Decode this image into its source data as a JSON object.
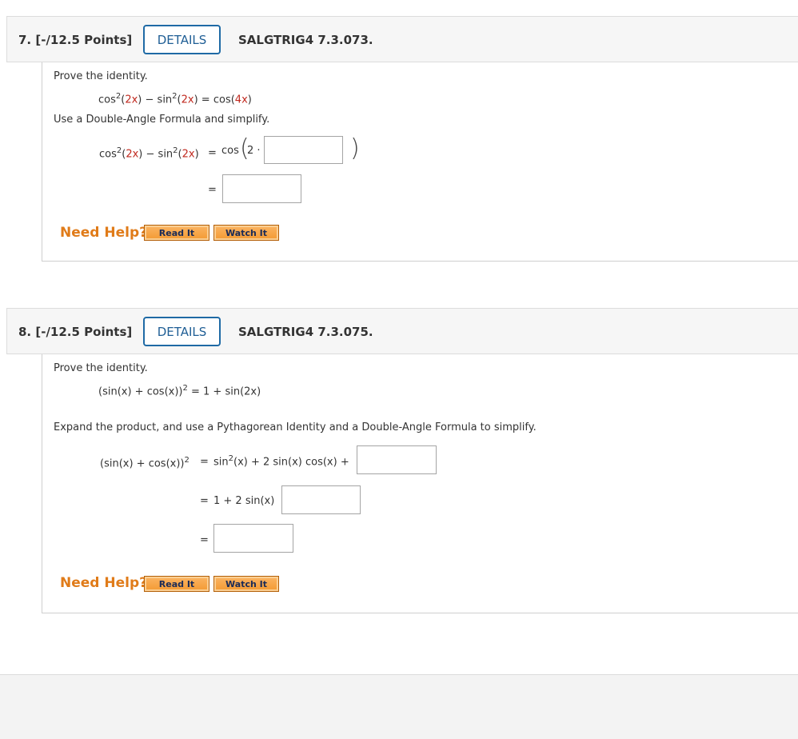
{
  "q7": {
    "number": "7. [-/12.5 Points]",
    "details_label": "DETAILS",
    "code": "SALGTRIG4 7.3.073.",
    "prove_label": "Prove the identity.",
    "identity": {
      "a_pre": "cos",
      "a_sup": "2",
      "a_open": "(",
      "a_arg": "2x",
      "a_close": ")",
      "minus": " − ",
      "b_pre": "sin",
      "b_sup": "2",
      "b_open": "(",
      "b_arg": "2x",
      "b_close": ")",
      "eq": " = ",
      "c_pre": "cos(",
      "c_arg": "4x",
      "c_close": ")"
    },
    "instruction": "Use a Double-Angle Formula and simplify.",
    "step1": {
      "a_pre": "cos",
      "a_sup": "2",
      "a_open": "(",
      "a_arg": "2x",
      "a_close": ")",
      "minus": " − ",
      "b_pre": "sin",
      "b_sup": "2",
      "b_open": "(",
      "b_arg": "2x",
      "b_close": ")",
      "eq": "=",
      "cos": "cos",
      "paren_open": "(",
      "two_dot": "2 ·",
      "paren_close": ")"
    },
    "step2_eq": "="
  },
  "q8": {
    "number": "8. [-/12.5 Points]",
    "details_label": "DETAILS",
    "code": "SALGTRIG4 7.3.075.",
    "prove_label": "Prove the identity.",
    "identity": {
      "lhs": "(sin(x) + cos(x))",
      "sup": "2",
      "rhs": " = 1 + sin(2x)"
    },
    "instruction": "Expand the product, and use a Pythagorean Identity and a Double-Angle Formula to simplify.",
    "step1": {
      "lhs": "(sin(x) + cos(x))",
      "lhs_sup": "2",
      "eq": "=",
      "rhs_pre": "sin",
      "rhs_sup": "2",
      "rhs_post": "(x) + 2 sin(x) cos(x) +"
    },
    "step2": {
      "eq": "=",
      "expr": "1 + 2 sin(x)"
    },
    "step3_eq": "="
  },
  "help": {
    "label": "Need Help?",
    "read_it": "Read It",
    "watch_it": "Watch It"
  }
}
